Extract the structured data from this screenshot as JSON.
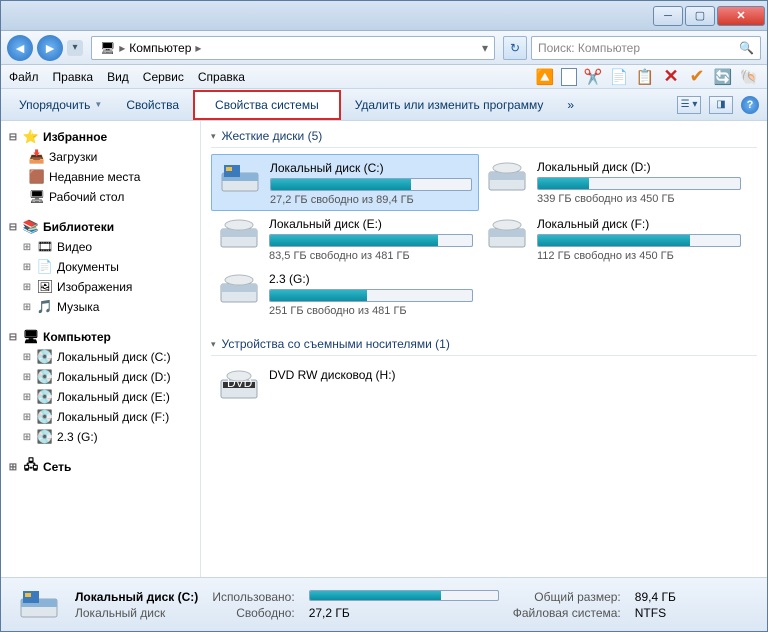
{
  "breadcrumb": {
    "root": "Компьютер"
  },
  "search": {
    "placeholder": "Поиск: Компьютер"
  },
  "menu": {
    "file": "Файл",
    "edit": "Правка",
    "view": "Вид",
    "service": "Сервис",
    "help": "Справка"
  },
  "toolbar": {
    "organize": "Упорядочить",
    "properties": "Свойства",
    "system_properties": "Свойства системы",
    "uninstall": "Удалить или изменить программу",
    "more": "»"
  },
  "sidebar": {
    "favorites": "Избранное",
    "downloads": "Загрузки",
    "recent": "Недавние места",
    "desktop": "Рабочий стол",
    "libraries": "Библиотеки",
    "video": "Видео",
    "documents": "Документы",
    "pictures": "Изображения",
    "music": "Музыка",
    "computer": "Компьютер",
    "disk_c": "Локальный диск (C:)",
    "disk_d": "Локальный диск (D:)",
    "disk_e": "Локальный диск (E:)",
    "disk_f": "Локальный диск (F:)",
    "disk_g": "2.3 (G:)",
    "network": "Сеть"
  },
  "groups": {
    "hdd": "Жесткие диски (5)",
    "removable": "Устройства со съемными носителями (1)"
  },
  "drives": [
    {
      "name": "Локальный диск (C:)",
      "free": "27,2 ГБ свободно из 89,4 ГБ",
      "pct": 70,
      "sel": true,
      "type": "os"
    },
    {
      "name": "Локальный диск (D:)",
      "free": "339 ГБ свободно из 450 ГБ",
      "pct": 25,
      "type": "hdd"
    },
    {
      "name": "Локальный диск (E:)",
      "free": "83,5 ГБ свободно из 481 ГБ",
      "pct": 83,
      "type": "hdd"
    },
    {
      "name": "Локальный диск (F:)",
      "free": "112 ГБ свободно из 450 ГБ",
      "pct": 75,
      "type": "hdd"
    },
    {
      "name": "2.3 (G:)",
      "free": "251 ГБ свободно из 481 ГБ",
      "pct": 48,
      "type": "hdd"
    }
  ],
  "dvd": {
    "name": "DVD RW дисковод (H:)"
  },
  "status": {
    "title": "Локальный диск (C:)",
    "subtitle": "Локальный диск",
    "used_k": "Использовано:",
    "used_v": "",
    "free_k": "Свободно:",
    "free_v": "27,2 ГБ",
    "total_k": "Общий размер:",
    "total_v": "89,4 ГБ",
    "fs_k": "Файловая система:",
    "fs_v": "NTFS",
    "pct": 70
  }
}
